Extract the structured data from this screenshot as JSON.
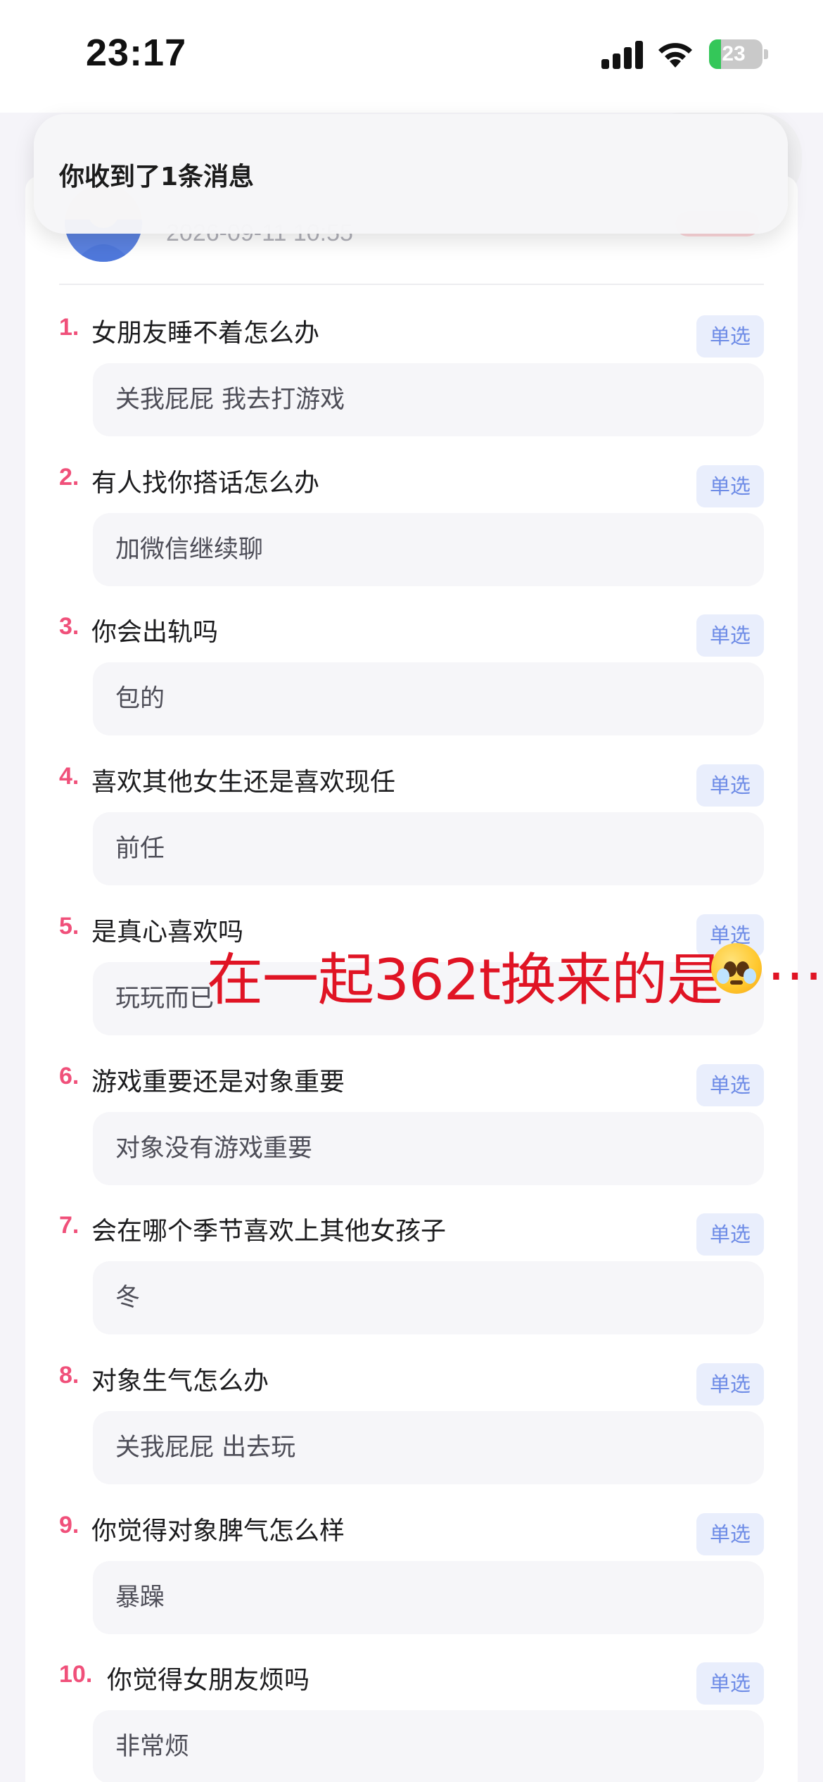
{
  "status": {
    "time": "23:17",
    "battery_percent": "23",
    "battery_level": 0.23,
    "signal_icon": "cellular-signal-icon",
    "wifi_icon": "wifi-icon",
    "battery_icon": "battery-charging-icon"
  },
  "notification": {
    "text": "你收到了1条消息"
  },
  "header": {
    "avatar_icon": "user-avatar",
    "date": "2026-09-11 10:55"
  },
  "badge_label": "单选",
  "questions": [
    {
      "num": "1.",
      "title": "女朋友睡不着怎么办",
      "answer": "关我屁屁 我去打游戏"
    },
    {
      "num": "2.",
      "title": "有人找你搭话怎么办",
      "answer": "加微信继续聊"
    },
    {
      "num": "3.",
      "title": "你会出轨吗",
      "answer": "包的"
    },
    {
      "num": "4.",
      "title": "喜欢其他女生还是喜欢现任",
      "answer": "前任"
    },
    {
      "num": "5.",
      "title": "是真心喜欢吗",
      "answer": "玩玩而已"
    },
    {
      "num": "6.",
      "title": "游戏重要还是对象重要",
      "answer": "对象没有游戏重要"
    },
    {
      "num": "7.",
      "title": "会在哪个季节喜欢上其他女孩子",
      "answer": "冬"
    },
    {
      "num": "8.",
      "title": "对象生气怎么办",
      "answer": "关我屁屁 出去玩"
    },
    {
      "num": "9.",
      "title": "你觉得对象脾气怎么样",
      "answer": "暴躁"
    },
    {
      "num": "10.",
      "title": "你觉得女朋友烦吗",
      "answer": "非常烦"
    }
  ],
  "overlay": {
    "text": "在一起362t换来的是",
    "emoji_icon": "pleading-face-emoji-icon",
    "ellipsis": "…",
    "color": "#e01424"
  },
  "colors": {
    "question_number": "#f0507a",
    "badge_text": "#6d8be6",
    "badge_bg": "#e9eefc"
  }
}
